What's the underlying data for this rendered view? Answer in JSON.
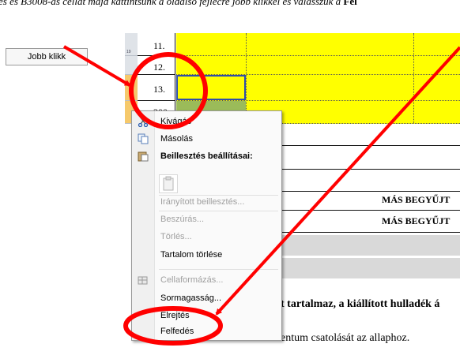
{
  "instruction_text": "és és B3008-as cellát majd kattintsunk a oldalsó fejlécre jobb klikkel és válasszuk a",
  "instruction_bold": "Fel",
  "callout_label": "Jobb klikk",
  "rows": [
    {
      "header": "19",
      "number": "11."
    },
    {
      "header": "",
      "number": "12."
    },
    {
      "header": "",
      "number": "13."
    },
    {
      "header": "",
      "number": "200."
    }
  ],
  "sheet": {
    "mas_begyujt_1": "MÁS BEGYŰJT",
    "mas_begyujt_2": "MÁS BEGYŰJT",
    "bold_line": "t tartalmaz, a kiállított hulladék á",
    "body_line": "entum csatolását az allaphoz."
  },
  "context_menu": {
    "cut": "Kivágás",
    "copy": "Másolás",
    "paste_options": "Beillesztés beállításai:",
    "paste_special": "Irányított beillesztés...",
    "insert": "Beszúrás...",
    "delete": "Törlés...",
    "clear_contents": "Tartalom törlése",
    "format_cells": "Cellaformázás...",
    "row_height": "Sormagasság...",
    "hide": "Elrejtés",
    "unhide": "Felfedés"
  },
  "colors": {
    "highlight_yellow": "#ffff00",
    "selection_green": "#9bbb59",
    "annotation_red": "#ff0000"
  }
}
